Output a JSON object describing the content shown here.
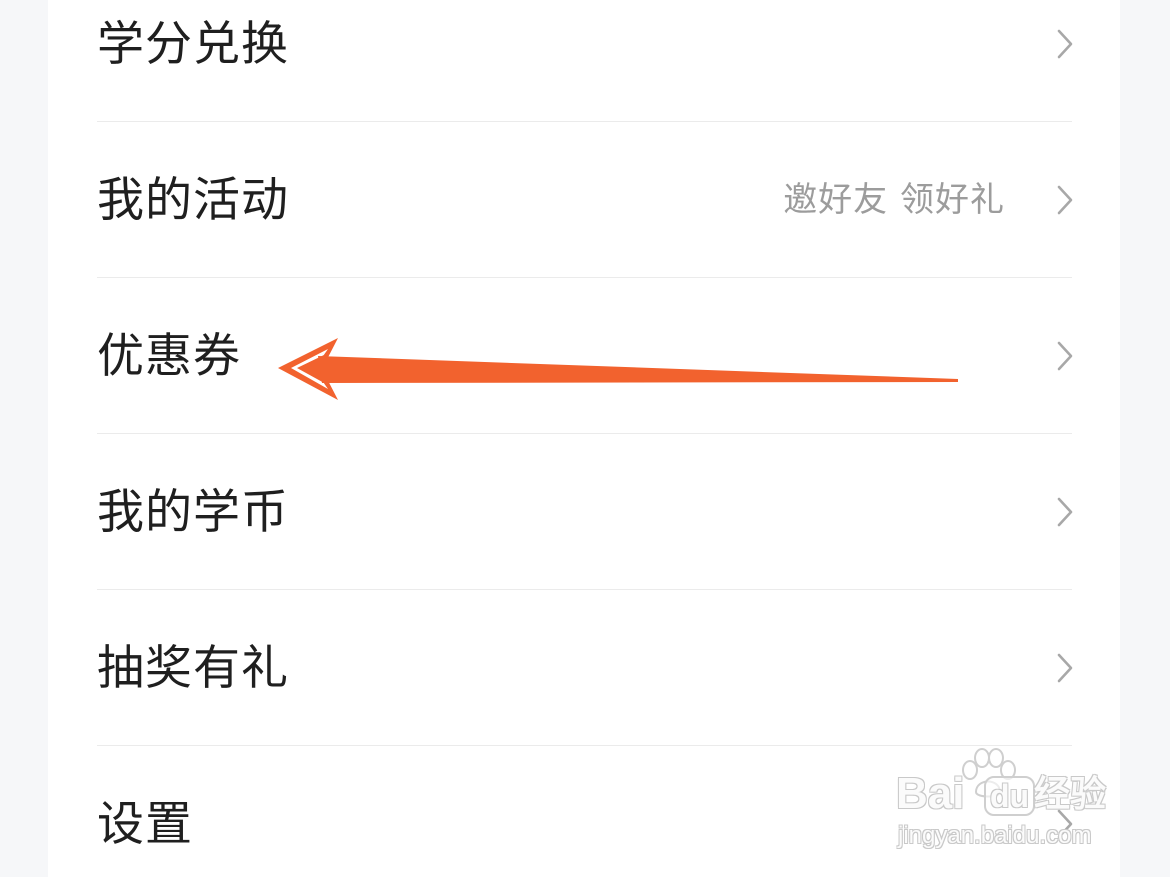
{
  "menu": {
    "items": [
      {
        "label": "学分兑换"
      },
      {
        "label": "我的活动",
        "hint": "邀好友 领好礼"
      },
      {
        "label": "优惠券"
      },
      {
        "label": "我的学币"
      },
      {
        "label": "抽奖有礼"
      },
      {
        "label": "设置"
      }
    ]
  },
  "icons": {
    "row_trailing": "chevron-right-icon",
    "watermark": "baidu-paw-icon"
  },
  "watermark": {
    "brand_left": "Bai",
    "brand_right": "du",
    "product": "经验",
    "url": "jingyan.baidu.com"
  },
  "colors": {
    "annotation_arrow": "#f2622e",
    "page_background": "#f6f7f9",
    "card_background": "#ffffff",
    "label_text": "#1f1f1f",
    "hint_text": "#9c9c9c",
    "chevron": "#a8a8a8"
  }
}
